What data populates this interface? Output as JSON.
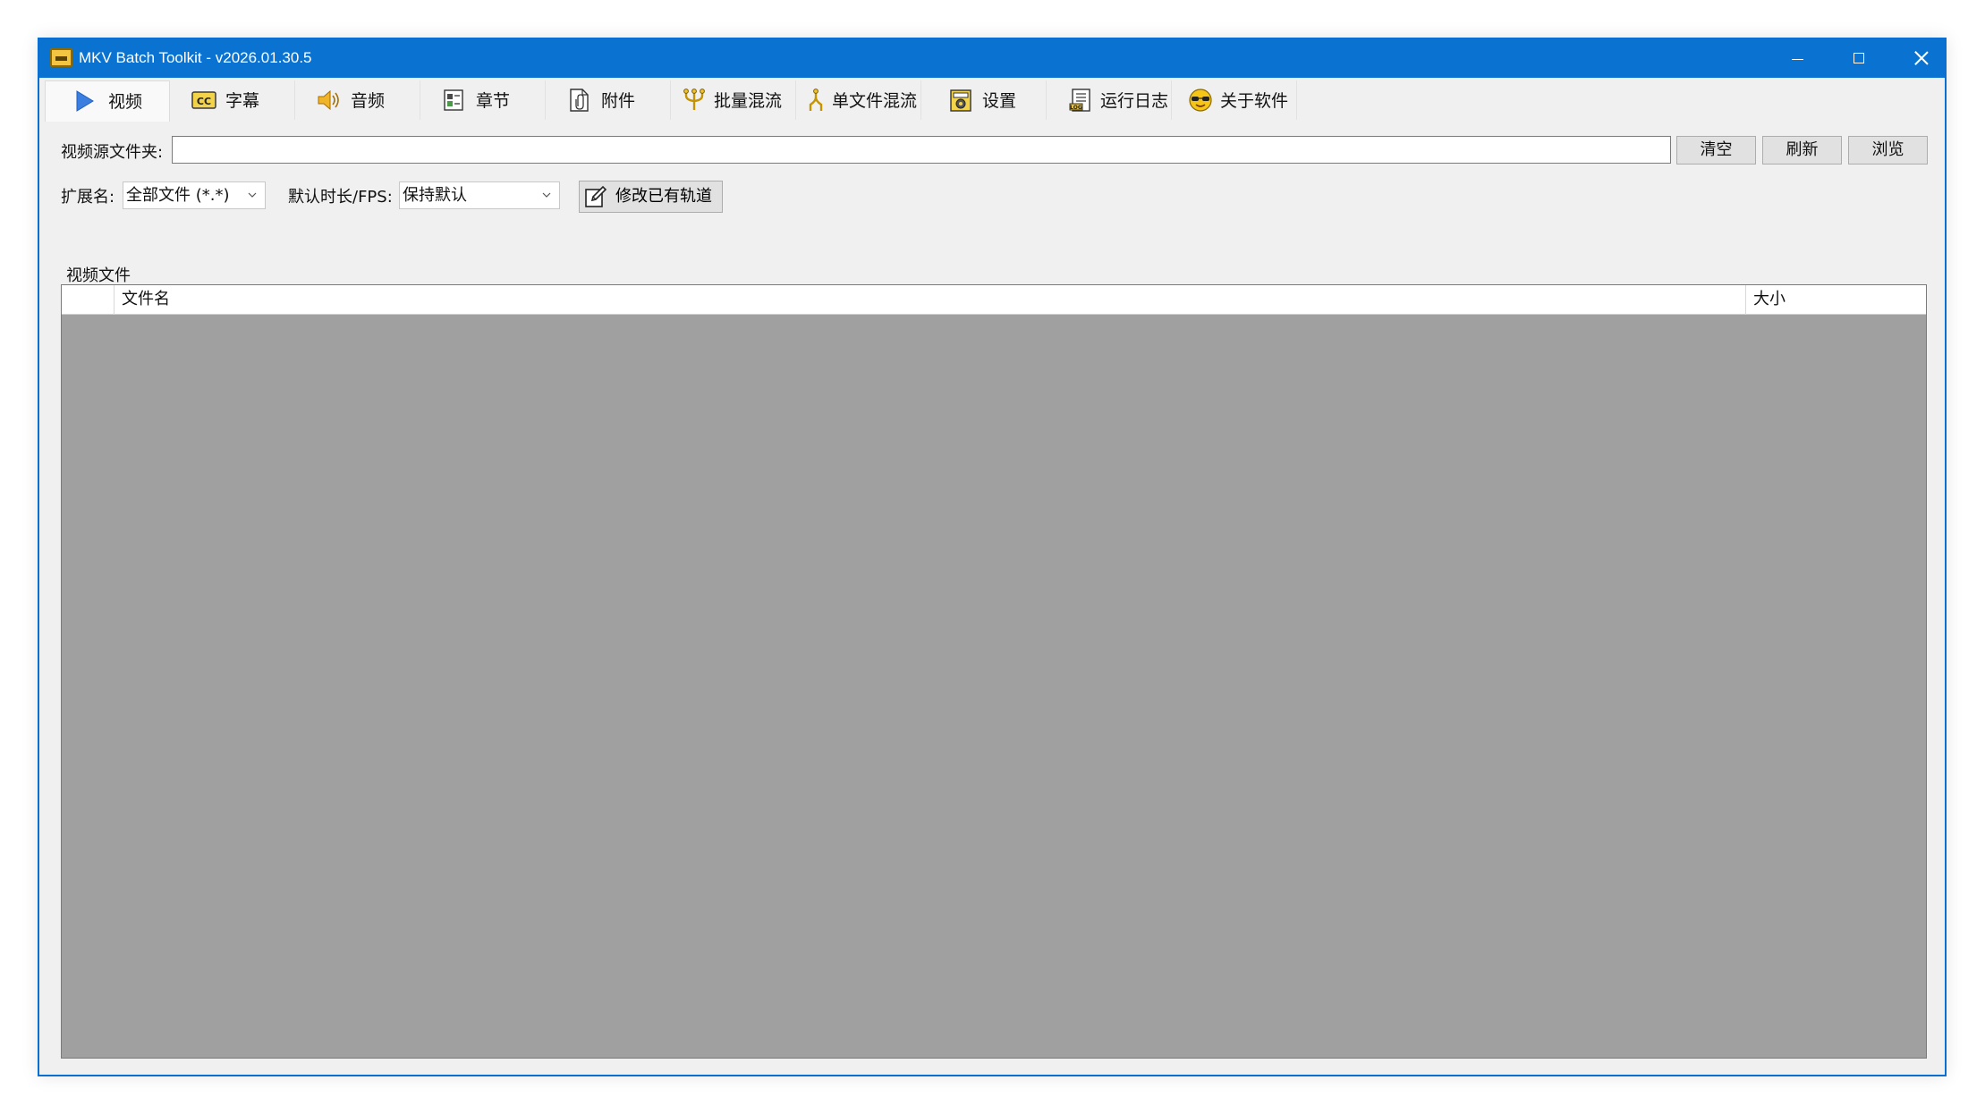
{
  "window": {
    "title": "MKV Batch Toolkit - v2026.01.30.5",
    "accent_color": "#0a73d2"
  },
  "tabs": [
    {
      "label": "视频",
      "icon": "play-icon",
      "active": true
    },
    {
      "label": "字幕",
      "icon": "cc-icon",
      "active": false
    },
    {
      "label": "音频",
      "icon": "speaker-icon",
      "active": false
    },
    {
      "label": "章节",
      "icon": "chapters-icon",
      "active": false
    },
    {
      "label": "附件",
      "icon": "attachment-icon",
      "active": false
    },
    {
      "label": "批量混流",
      "icon": "batch-mux-icon",
      "active": false
    },
    {
      "label": "单文件混流",
      "icon": "single-mux-icon",
      "active": false
    },
    {
      "label": "设置",
      "icon": "settings-icon",
      "active": false
    },
    {
      "label": "运行日志",
      "icon": "log-icon",
      "active": false
    },
    {
      "label": "关于软件",
      "icon": "about-icon",
      "active": false
    }
  ],
  "video": {
    "source_folder_label": "视频源文件夹:",
    "source_folder_value": "",
    "clear_label": "清空",
    "refresh_label": "刷新",
    "browse_label": "浏览",
    "extension_label": "扩展名:",
    "extension_value": "全部文件 (*.*)",
    "duration_fps_label": "默认时长/FPS:",
    "duration_fps_value": "保持默认",
    "edit_tracks_label": "修改已有轨道",
    "group_label": "视频文件",
    "columns": {
      "checkbox": "",
      "filename": "文件名",
      "size": "大小"
    }
  }
}
